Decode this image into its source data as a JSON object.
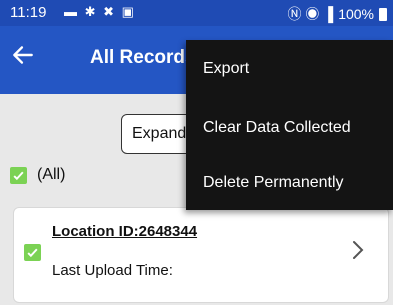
{
  "status_bar": {
    "time": "11:19",
    "icons_left": "▬ ✱ ✖ ▣",
    "signal_icons": "Ⓝ ◉ ▐",
    "battery": "100%"
  },
  "app_bar": {
    "back_icon": "arrow-left-icon",
    "title": "All Records"
  },
  "expand_button": {
    "label": "Expand"
  },
  "select_all": {
    "label": "(All)",
    "checked": true
  },
  "record": {
    "location": "Location ID:2648344",
    "last_upload_label": "Last Upload Time:",
    "checked": true
  },
  "menu": {
    "items": [
      "Export",
      "Clear Data Collected",
      "Delete Permanently"
    ]
  },
  "colors": {
    "status_bar": "#1f4bb4",
    "app_bar": "#2456c4",
    "checkbox": "#7bd254",
    "menu_bg": "#141414",
    "background": "#e8e8e8"
  }
}
